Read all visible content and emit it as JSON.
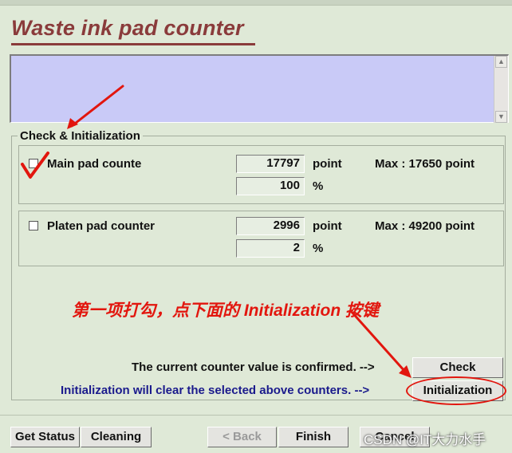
{
  "title": "Waste ink pad counter",
  "group_title": "Check & Initialization",
  "main_pad": {
    "label": "Main pad counte",
    "value": "17797",
    "unit": "point",
    "percent": "100",
    "percent_unit": "%",
    "max": "Max : 17650 point"
  },
  "platen_pad": {
    "label": "Platen pad counter",
    "value": "2996",
    "unit": "point",
    "percent": "2",
    "percent_unit": "%",
    "max": "Max : 49200 point"
  },
  "annotation_text": "第一项打勾，点下面的 Initialization 按键",
  "confirm_text": "The current counter value is confirmed. -->",
  "init_text": "Initialization will clear the selected above counters. -->",
  "buttons": {
    "check": "Check",
    "initialization": "Initialization",
    "get_status": "Get Status",
    "cleaning": "Cleaning",
    "back": "< Back",
    "finish": "Finish",
    "cancel": "Cancel"
  },
  "watermark": "CSDN @IT大力水手",
  "colors": {
    "background": "#dfe9d7",
    "title": "#8a3b3b",
    "message_box": "#c9caf7",
    "annotation_red": "#e2160e",
    "info_blue": "#1a1a8c"
  }
}
